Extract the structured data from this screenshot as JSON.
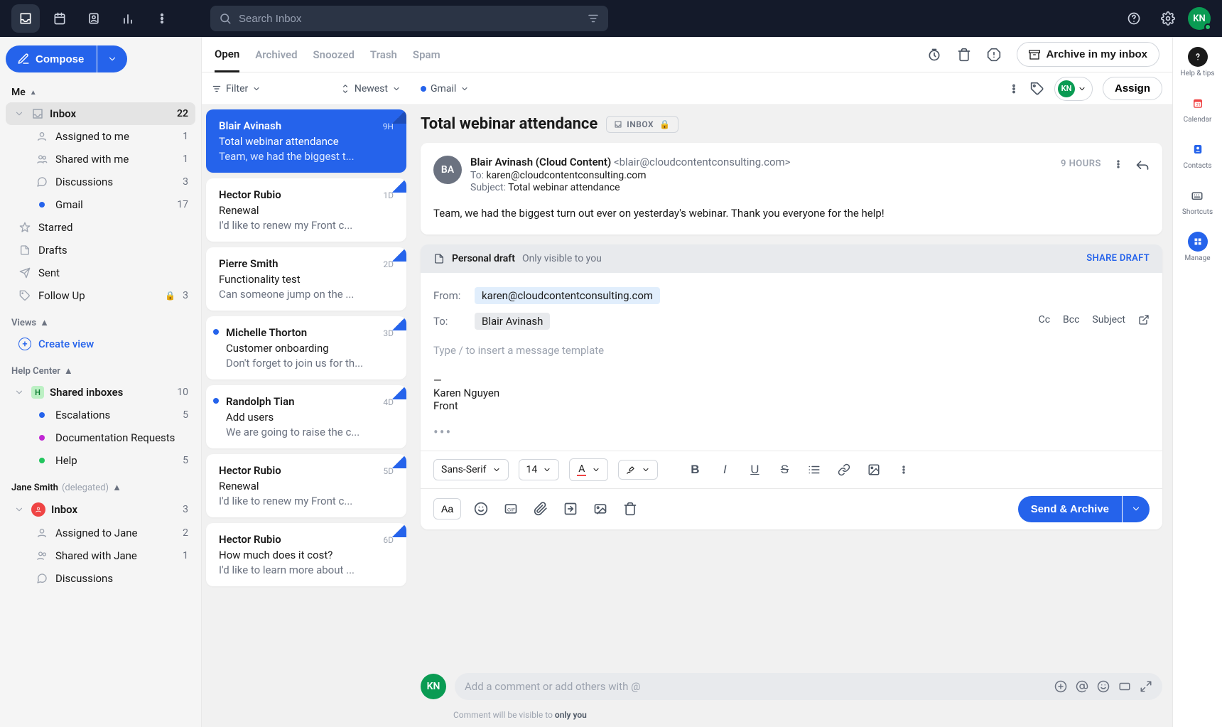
{
  "search_placeholder": "Search Inbox",
  "user_avatar": "KN",
  "compose_label": "Compose",
  "sidebar": {
    "me": {
      "header": "Me",
      "items": [
        {
          "label": "Inbox",
          "count": "22",
          "active": true
        },
        {
          "label": "Assigned to me",
          "count": "1"
        },
        {
          "label": "Shared with me",
          "count": "1"
        },
        {
          "label": "Discussions",
          "count": "3"
        },
        {
          "label": "Gmail",
          "count": "17"
        },
        {
          "label": "Starred"
        },
        {
          "label": "Drafts"
        },
        {
          "label": "Sent"
        },
        {
          "label": "Follow Up",
          "count": "3",
          "locked": true
        }
      ]
    },
    "views": {
      "header": "Views",
      "create": "Create view"
    },
    "help_center": {
      "header": "Help Center",
      "root": "Shared inboxes",
      "root_count": "10",
      "items": [
        {
          "label": "Escalations",
          "count": "5",
          "color": "#2563eb"
        },
        {
          "label": "Documentation Requests",
          "color": "#c026d3"
        },
        {
          "label": "Help",
          "count": "5",
          "color": "#22c55e"
        }
      ]
    },
    "delegated": {
      "header": "Jane Smith",
      "note": "(delegated)",
      "root": "Inbox",
      "root_count": "3",
      "items": [
        {
          "label": "Assigned to Jane",
          "count": "2"
        },
        {
          "label": "Shared with Jane",
          "count": "1"
        },
        {
          "label": "Discussions"
        }
      ]
    }
  },
  "tabs": {
    "open": "Open",
    "archived": "Archived",
    "snoozed": "Snoozed",
    "trash": "Trash",
    "spam": "Spam",
    "archive_action": "Archive in my inbox"
  },
  "filters": {
    "filter": "Filter",
    "sort": "Newest"
  },
  "channel": "Gmail",
  "assign": "Assign",
  "conversations": [
    {
      "sender": "Blair Avinash",
      "time": "9H",
      "subject": "Total webinar attendance",
      "preview": "Team, we had the biggest t...",
      "active": true,
      "corner": true
    },
    {
      "sender": "Hector Rubio",
      "time": "1D",
      "subject": "Renewal",
      "preview": "I'd like to renew my Front c...",
      "corner": true
    },
    {
      "sender": "Pierre Smith",
      "time": "2D",
      "subject": "Functionality test",
      "preview": "Can someone jump on the ...",
      "corner": true
    },
    {
      "sender": "Michelle Thorton",
      "time": "3D",
      "subject": "Customer onboarding",
      "preview": "Don't forget to join us for th...",
      "corner": true,
      "unread": true
    },
    {
      "sender": "Randolph Tian",
      "time": "4D",
      "subject": "Add users",
      "preview": "We are going to raise the c...",
      "corner": true,
      "unread": true
    },
    {
      "sender": "Hector Rubio",
      "time": "5D",
      "subject": "Renewal",
      "preview": "I'd like to renew my Front c...",
      "corner": true
    },
    {
      "sender": "Hector Rubio",
      "time": "6D",
      "subject": "How much does it cost?",
      "preview": "I'd like to learn more about ...",
      "corner": true
    }
  ],
  "detail": {
    "subject": "Total webinar attendance",
    "badge": "INBOX",
    "from_name": "Blair Avinash (Cloud Content)",
    "from_email": "<blair@cloudcontentconsulting.com>",
    "to_label": "To:",
    "to": "karen@cloudcontentconsulting.com",
    "subject_label": "Subject:",
    "subject_val": "Total webinar attendance",
    "time": "9 HOURS",
    "avatar": "BA",
    "body": "Team, we had the biggest turn out ever on yesterday's webinar. Thank you everyone for the help!"
  },
  "draft": {
    "title": "Personal draft",
    "note": "Only visible to you",
    "share": "SHARE DRAFT",
    "from_label": "From:",
    "from": "karen@cloudcontentconsulting.com",
    "to_label": "To:",
    "to": "Blair Avinash",
    "cc": "Cc",
    "bcc": "Bcc",
    "subject": "Subject",
    "placeholder": "Type / to insert a message template",
    "sig_sep": "—",
    "sig_name": "Karen Nguyen",
    "sig_company": "Front",
    "font": "Sans-Serif",
    "font_size": "14",
    "aa": "Aa",
    "send": "Send & Archive"
  },
  "comment": {
    "placeholder": "Add a comment or add others with @",
    "note_prefix": "Comment will be visible to",
    "note_bold": "only you"
  },
  "rail": {
    "help": "Help & tips",
    "calendar": "Calendar",
    "contacts": "Contacts",
    "shortcuts": "Shortcuts",
    "manage": "Manage"
  }
}
